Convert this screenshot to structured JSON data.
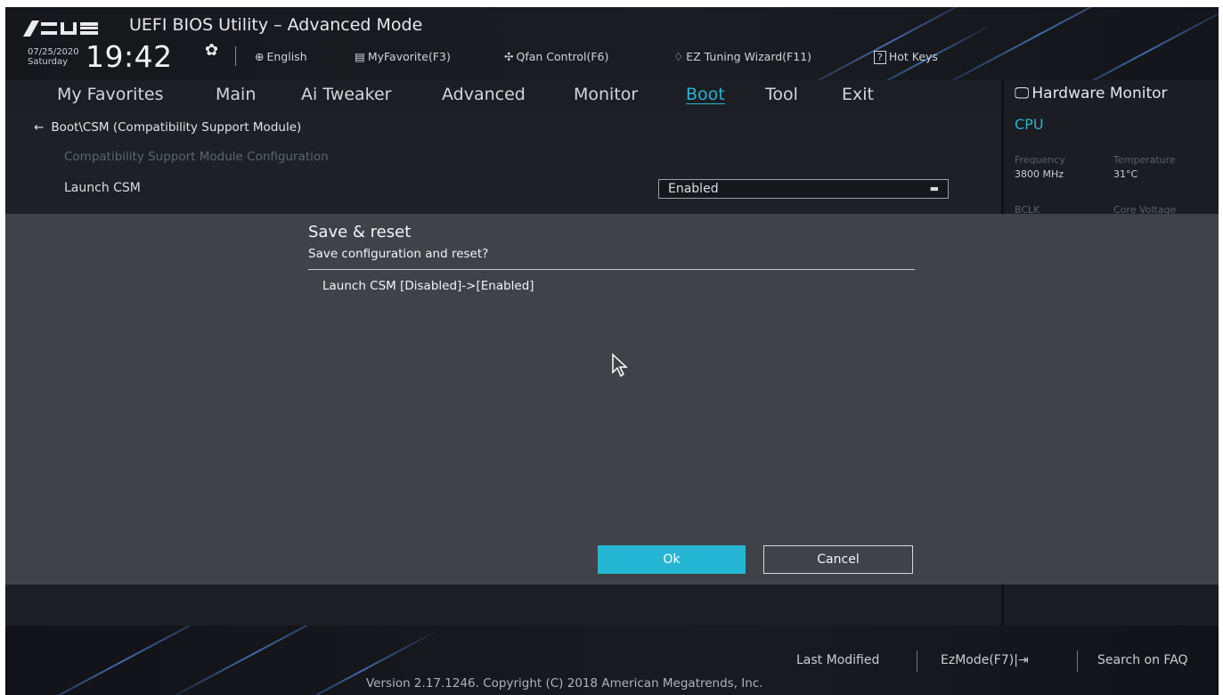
{
  "header": {
    "title": "UEFI BIOS Utility – Advanced Mode",
    "date": "07/25/2020",
    "weekday": "Saturday",
    "time": "19:42",
    "items": [
      {
        "icon": "globe-icon",
        "label": "English"
      },
      {
        "icon": "star-list-icon",
        "label": "MyFavorite(F3)"
      },
      {
        "icon": "fan-icon",
        "label": "Qfan Control(F6)"
      },
      {
        "icon": "bulb-icon",
        "label": "EZ Tuning Wizard(F11)"
      },
      {
        "icon": "help-icon",
        "label": "Hot Keys"
      }
    ]
  },
  "nav": {
    "tabs": [
      "My Favorites",
      "Main",
      "Ai Tweaker",
      "Advanced",
      "Monitor",
      "Boot",
      "Tool",
      "Exit"
    ],
    "active": "Boot"
  },
  "content": {
    "breadcrumb": "Boot\\CSM (Compatibility Support Module)",
    "section": "Compatibility Support Module Configuration",
    "setting_label": "Launch CSM",
    "setting_value": "Enabled"
  },
  "hw_monitor": {
    "title": "Hardware Monitor",
    "cpu": "CPU",
    "frequency_label": "Frequency",
    "frequency_value": "3800 MHz",
    "temperature_label": "Temperature",
    "temperature_value": "31°C",
    "bclk_label": "BCLK",
    "core_voltage_label": "Core Voltage"
  },
  "dialog": {
    "title": "Save & reset",
    "subtitle": "Save configuration and reset?",
    "change": "Launch CSM [Disabled]->[Enabled]",
    "ok": "Ok",
    "cancel": "Cancel"
  },
  "footer": {
    "last_modified": "Last Modified",
    "ezmode": "EzMode(F7)|",
    "search": "Search on FAQ",
    "version": "Version 2.17.1246. Copyright (C) 2018 American Megatrends, Inc."
  },
  "colors": {
    "accent": "#25b6d3",
    "background": "#1d2024",
    "dialog": "#3f4246"
  }
}
